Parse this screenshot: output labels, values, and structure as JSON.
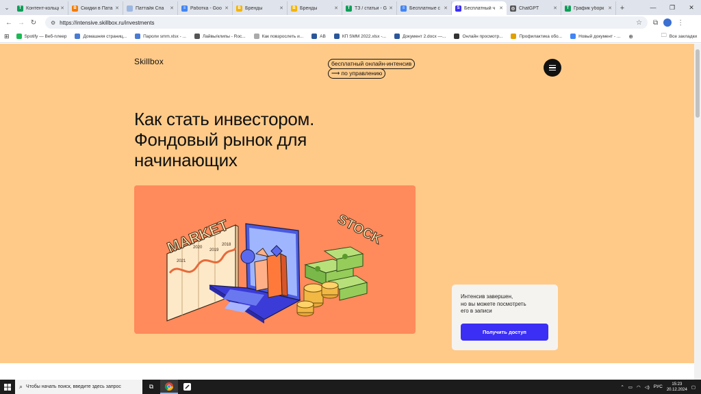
{
  "browser": {
    "tabs": [
      {
        "title": "Контент-кольцо",
        "icon": "sheets-icon",
        "color": "#0f9d58",
        "letter": "T"
      },
      {
        "title": "Скидки в Пата",
        "icon": "blogger-icon",
        "color": "#f57c00",
        "letter": "B"
      },
      {
        "title": "Паттайя Спа",
        "icon": "page-icon",
        "color": "#9bb7e0",
        "letter": ""
      },
      {
        "title": "Работка - Goo",
        "icon": "docs-icon",
        "color": "#4285f4",
        "letter": "≡"
      },
      {
        "title": "Бренды",
        "icon": "slides-icon",
        "color": "#f4b400",
        "letter": "B"
      },
      {
        "title": "Бренды",
        "icon": "slides-icon",
        "color": "#f4b400",
        "letter": "B"
      },
      {
        "title": "ТЗ / статьи - G",
        "icon": "sheets-icon",
        "color": "#0f9d58",
        "letter": "T"
      },
      {
        "title": "Бесплатные с",
        "icon": "docs-icon",
        "color": "#4285f4",
        "letter": "≡"
      },
      {
        "title": "Бесплатный ч",
        "icon": "skillbox-icon",
        "color": "#3b2ef5",
        "letter": "S",
        "active": true
      },
      {
        "title": "ChatGPT",
        "icon": "chatgpt-icon",
        "color": "#555555",
        "letter": "◎"
      },
      {
        "title": "График уборк",
        "icon": "sheets-icon",
        "color": "#0f9d58",
        "letter": "T"
      }
    ],
    "url": "https://intensive.skillbox.ru/investments",
    "bookmarks": [
      {
        "label": "Spotify — Веб-плеер",
        "color": "#1db954"
      },
      {
        "label": "Домашняя страниц...",
        "color": "#4a7bd0"
      },
      {
        "label": "Пароли smm.xlsx - ...",
        "color": "#4a7bd0"
      },
      {
        "label": "Лайвы/клипы - Roc...",
        "color": "#555555"
      },
      {
        "label": "Как повзрослеть и...",
        "color": "#aaaaaa"
      },
      {
        "label": "AB",
        "color": "#2b579a"
      },
      {
        "label": "КП SMM 2022.xlsx -...",
        "color": "#2b579a"
      },
      {
        "label": "Документ 2.docx —...",
        "color": "#2b579a"
      },
      {
        "label": "Онлайн просмотр...",
        "color": "#333333"
      },
      {
        "label": "Профилактика обо...",
        "color": "#e0a000"
      },
      {
        "label": "Новый документ - ...",
        "color": "#4285f4"
      }
    ],
    "all_bookmarks": "Все закладки"
  },
  "page": {
    "logo": "Skillbox",
    "badge_line1": "бесплатный онлайн-интенсив",
    "badge_line2": "⟶ по управлению",
    "title_line1": "Как стать инвестором.",
    "title_line2": "Фондовый рынок для",
    "title_line3": "начинающих",
    "illustration": {
      "market_text": "MARKET",
      "stock_text": "STOCK",
      "years": [
        "2021",
        "2020",
        "2019",
        "2018"
      ]
    },
    "card_text_1": "Интенсив завершен,",
    "card_text_2": "но вы можете посмотреть",
    "card_text_3": "его в записи",
    "card_button": "Получить доступ"
  },
  "taskbar": {
    "search_placeholder": "Чтобы начать поиск, введите здесь запрос",
    "language": "РУС",
    "time": "15:23",
    "date": "20.12.2024"
  },
  "colors": {
    "page_bg": "#ffca88",
    "illustration_bg": "#ff8a5b",
    "cta": "#3b2ef5"
  }
}
